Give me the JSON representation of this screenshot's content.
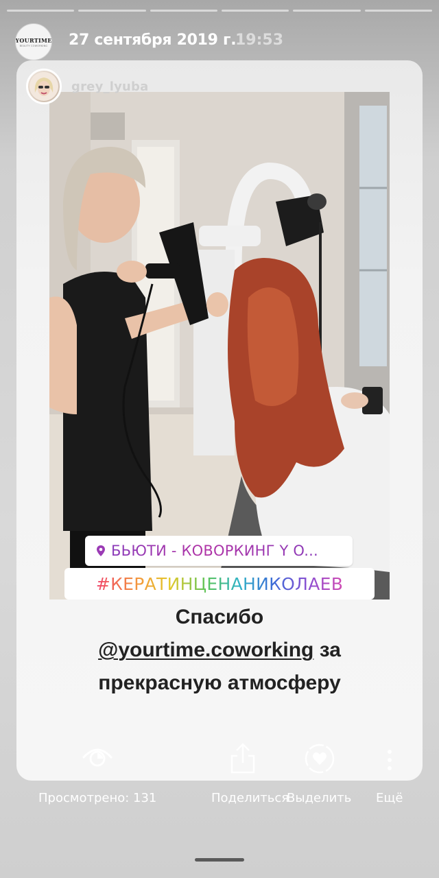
{
  "story": {
    "progress_segments": 6,
    "account_logo_text": "YOURTIME",
    "account_logo_subtext": "BEAUTY COWORKING",
    "date": "27 сентября 2019 г.",
    "time": "19:53"
  },
  "reshared_post": {
    "username": "grey_lyuba",
    "avatar_icon": "profile-avatar"
  },
  "stickers": {
    "location": "БЬЮТИ - КОВОРКИНГ Y O...",
    "location_icon": "location-pin-icon",
    "location_color": "#8a3ab9",
    "hashtag": "#КЕРАТИНЦЕНАНИКОЛАЕВ"
  },
  "caption": {
    "line1": "Спасибо",
    "mention": "@yourtime.coworking",
    "line2_rest": " за",
    "line3": "прекрасную атмосферу"
  },
  "actions": {
    "seen_label": "Просмотрено: 131",
    "share_label": "Поделиться",
    "highlight_label": "Выделить",
    "more_label": "Ещё"
  },
  "colors": {
    "background": "#d9d9d9",
    "card": "#f3f3f3",
    "text_white": "#ffffff",
    "caption_text": "#222222"
  }
}
